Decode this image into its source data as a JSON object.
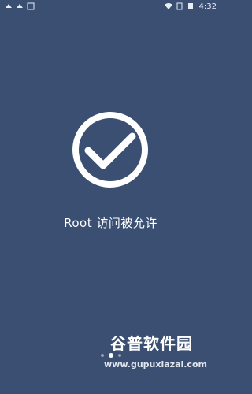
{
  "status_bar": {
    "time": "4:32",
    "left_icons": [
      "notification-icon",
      "notification-icon",
      "text-icon"
    ],
    "right_icons": [
      "wifi-icon",
      "sim-icon",
      "battery-icon"
    ]
  },
  "screen": {
    "message": "Root 访问被允许"
  },
  "pager": {
    "dots": 3,
    "active_index": 1
  },
  "watermark": {
    "brand": "谷普软件园",
    "url": "www.gupuxiazai.com"
  },
  "colors": {
    "background": "#3a4f72",
    "foreground": "#ffffff"
  }
}
